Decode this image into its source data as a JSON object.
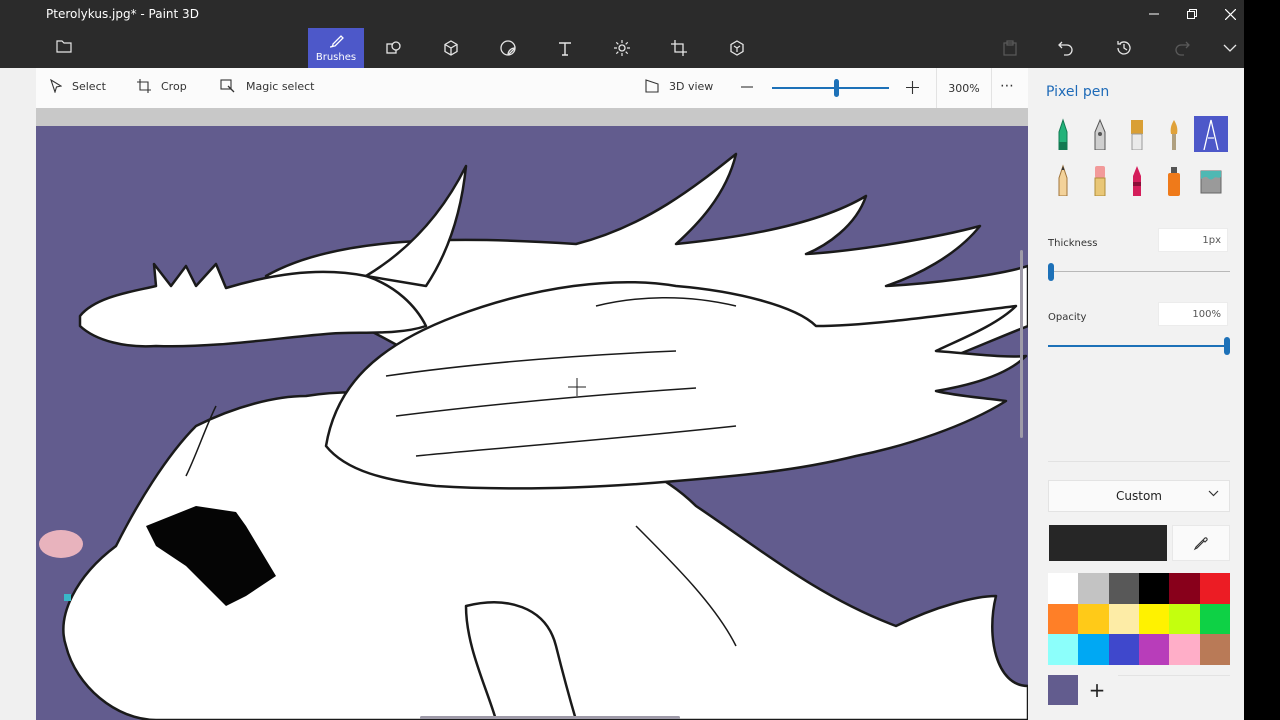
{
  "window": {
    "title": "Pterolykus.jpg* - Paint 3D"
  },
  "ribbon": {
    "tools": [
      {
        "id": "brushes",
        "label": "Brushes",
        "icon": "brush-icon",
        "active": true
      },
      {
        "id": "2d-shapes",
        "label": "",
        "icon": "2d-shapes-icon"
      },
      {
        "id": "3d-shapes",
        "label": "",
        "icon": "3d-cube-icon"
      },
      {
        "id": "stickers",
        "label": "",
        "icon": "sticker-icon"
      },
      {
        "id": "text",
        "label": "",
        "icon": "text-icon"
      },
      {
        "id": "effects",
        "label": "",
        "icon": "effects-icon"
      },
      {
        "id": "canvas",
        "label": "",
        "icon": "canvas-icon"
      },
      {
        "id": "3d-library",
        "label": "",
        "icon": "3d-library-icon"
      }
    ]
  },
  "commandbar": {
    "select_label": "Select",
    "crop_label": "Crop",
    "magic_select_label": "Magic select",
    "view3d_label": "3D view",
    "zoom_value": "300%",
    "zoom_fraction": 0.55,
    "more_label": "⋯"
  },
  "panel": {
    "title": "Pixel pen",
    "brushes": [
      {
        "name": "marker",
        "color": "#22b37a"
      },
      {
        "name": "calligraphy-pen",
        "color": "#7e7e7e"
      },
      {
        "name": "oil-brush",
        "color": "#d99f35"
      },
      {
        "name": "watercolor",
        "color": "#e0a23a"
      },
      {
        "name": "pixel-pen",
        "color": "#ffffff",
        "selected": true
      },
      {
        "name": "pencil",
        "color": "#d9883b"
      },
      {
        "name": "eraser",
        "color": "#f29a9a"
      },
      {
        "name": "crayon",
        "color": "#d41e5b"
      },
      {
        "name": "spray-can",
        "color": "#ef7a1a"
      },
      {
        "name": "fill",
        "color": "#4fb8b3"
      }
    ],
    "thickness_label": "Thickness",
    "thickness_value": "1px",
    "thickness_fraction": 0.0,
    "opacity_label": "Opacity",
    "opacity_value": "100%",
    "opacity_fraction": 1.0,
    "color_mode": "Custom",
    "current_color": "#262626",
    "custom_color": "#625c8e",
    "add_color_label": "+",
    "swatches": [
      "#ffffff",
      "#c3c3c3",
      "#585858",
      "#000000",
      "#88001b",
      "#ec1c24",
      "#ff7f27",
      "#ffca18",
      "#fdeca6",
      "#fff200",
      "#c4ff0e",
      "#0ed145",
      "#8cfffb",
      "#00a8f3",
      "#3f48cc",
      "#b83dba",
      "#ffaec8",
      "#b97a57"
    ]
  }
}
